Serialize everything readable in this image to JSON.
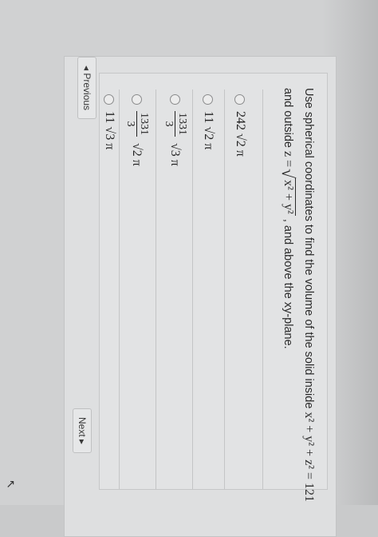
{
  "question": {
    "prefix": "Use spherical coordinates to find the volume of the solid inside",
    "equation": "x² + y² + z² = 121",
    "and_outside": "and outside",
    "z_eq": "z =",
    "sqrt_inner": "x² + y²",
    "suffix": ", and above the xy-plane."
  },
  "options": [
    {
      "text": "242 √2 π"
    },
    {
      "text": "11 √2 π"
    },
    {
      "num": "1331",
      "den": "3",
      "rest": "√3 π"
    },
    {
      "num": "1331",
      "den": "3",
      "rest": "√2 π"
    },
    {
      "text": "11 √3 π"
    }
  ],
  "nav": {
    "previous": "◂ Previous",
    "next": "Next ▸"
  }
}
